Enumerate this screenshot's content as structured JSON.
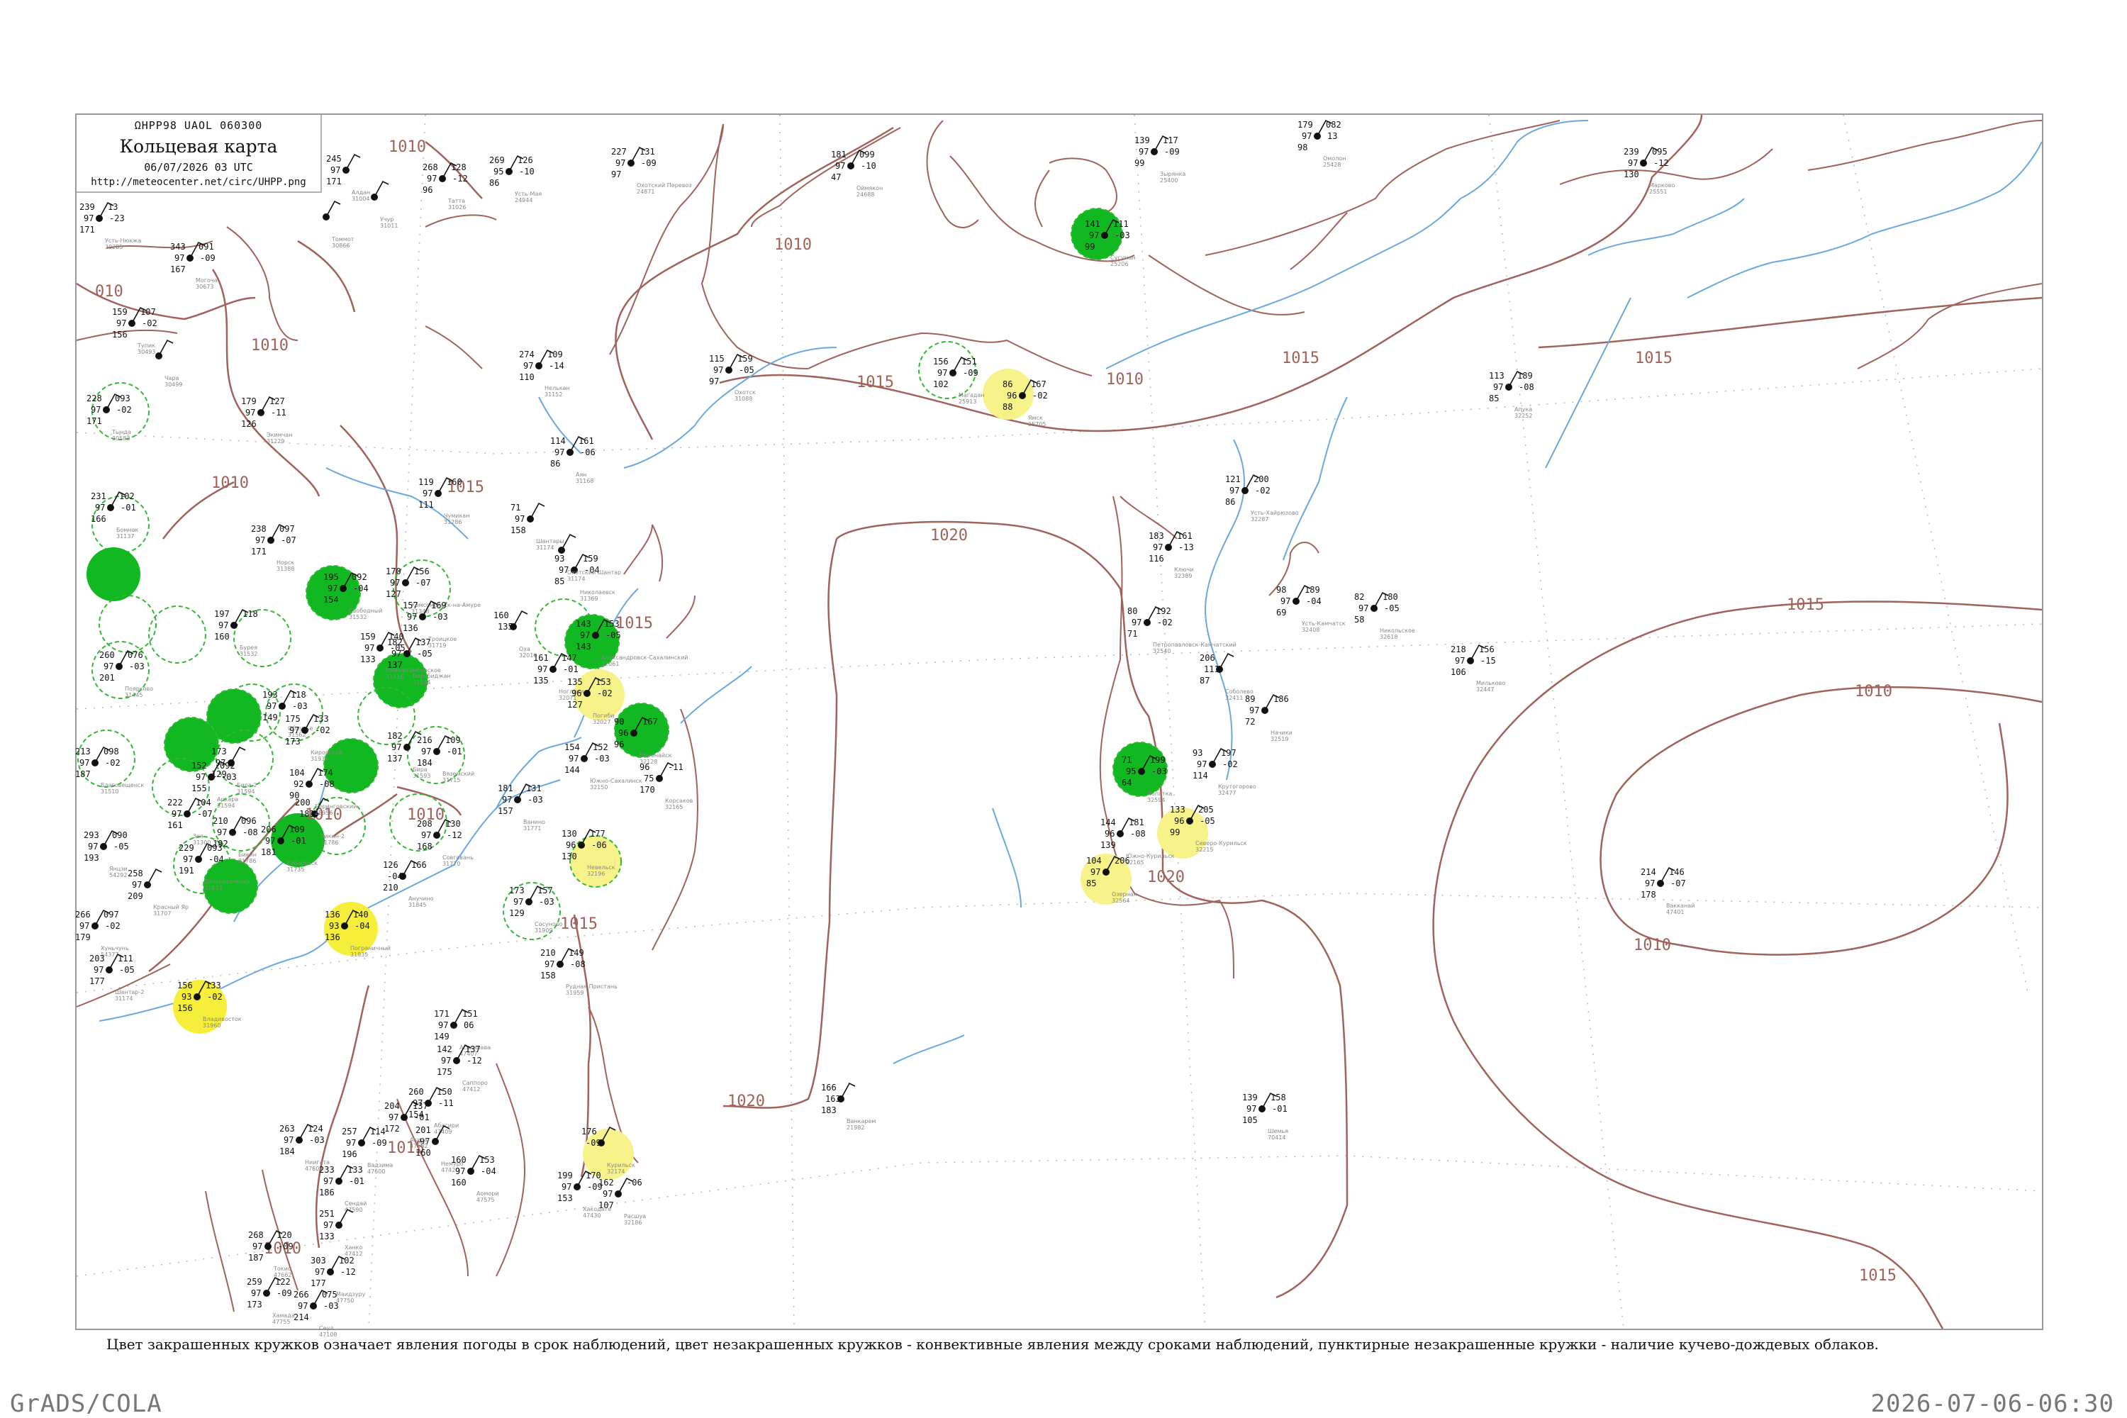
{
  "header": {
    "code": "ΩHPP98  UAOL  060300",
    "title": "Кольцевая карта",
    "date": "06/07/2026 03 UTC",
    "url": "http://meteocenter.net/circ/UHPP.png"
  },
  "caption": "Цвет закрашенных кружков означает явления погоды в срок наблюдений, цвет незакрашенных кружков - конвективные явления между сроками наблюдений, пунктирные незакрашенные кружки - наличие кучево-дождевых облаков.",
  "footer": {
    "left": "GrADS/COLA",
    "right": "2026-07-06-06:30"
  },
  "colors": {
    "isobar": "#a0625a",
    "coast": "#a0625a",
    "river": "#6aa8e0",
    "green": "#11b821",
    "yellow": "#f5ee3a",
    "light_yellow": "#f7f28a",
    "dashed_green": "#33b833",
    "frame": "#9a9a9a"
  },
  "isobar_labels": [
    "010",
    "1010",
    "1010",
    "1010",
    "1010",
    "1015",
    "1015",
    "1010",
    "1015",
    "1020",
    "1015",
    "1010",
    "1010",
    "1015",
    "1010",
    "1010",
    "1015",
    "1015",
    "1015",
    "1020",
    "1020",
    "1010",
    "1015"
  ],
  "stations": [
    {
      "name": "Усть-Нюкжа",
      "id": "30285",
      "obs": [
        "239",
        "97",
        "171",
        "13",
        "-23"
      ],
      "marker": "none"
    },
    {
      "name": "Могоча",
      "id": "30673",
      "obs": [
        "343",
        "97",
        "167",
        "091",
        "-09"
      ],
      "marker": "none"
    },
    {
      "name": "Тупик",
      "id": "30493",
      "obs": [
        "159",
        "97",
        "156",
        "107",
        "-02"
      ],
      "marker": "none"
    },
    {
      "name": "Чара",
      "id": "30499",
      "obs": [],
      "marker": "none"
    },
    {
      "name": "Алдан",
      "id": "31004",
      "obs": [
        "245",
        "97",
        "171"
      ],
      "marker": "none"
    },
    {
      "name": "Томмот",
      "id": "30866",
      "obs": [],
      "marker": "none"
    },
    {
      "name": "Учур",
      "id": "31011",
      "obs": [],
      "marker": "none"
    },
    {
      "name": "Татта",
      "id": "31026",
      "obs": [
        "268",
        "97",
        "96",
        "128",
        "-12"
      ],
      "marker": "none"
    },
    {
      "name": "Усть-Мая",
      "id": "24944",
      "obs": [
        "269",
        "95",
        "86",
        "126",
        "-10"
      ],
      "marker": "none"
    },
    {
      "name": "Оймякон",
      "id": "24688",
      "obs": [
        "181",
        "97",
        "47",
        "099",
        "-10"
      ],
      "marker": "none"
    },
    {
      "name": "Охотский Перевоз",
      "id": "24871",
      "obs": [
        "227",
        "97",
        "97",
        "131",
        "-09"
      ],
      "marker": "none"
    },
    {
      "name": "Зырянка",
      "id": "25400",
      "obs": [
        "139",
        "97",
        "99",
        "117",
        "-09"
      ],
      "marker": "none"
    },
    {
      "name": "Омолон",
      "id": "25428",
      "obs": [
        "179",
        "97",
        "98",
        "082",
        "13"
      ],
      "marker": "none"
    },
    {
      "name": "Марково",
      "id": "25551",
      "obs": [
        "239",
        "97",
        "130",
        "095",
        "-12"
      ],
      "marker": "none"
    },
    {
      "name": "Сусуман",
      "id": "25206",
      "obs": [
        "141",
        "97",
        "99",
        "111",
        "-03"
      ],
      "marker": "green"
    },
    {
      "name": "Аян",
      "id": "31168",
      "obs": [
        "114",
        "97",
        "86",
        "161",
        "-06"
      ],
      "marker": "none"
    },
    {
      "name": "Магадан",
      "id": "25913",
      "obs": [
        "156",
        "97",
        "102",
        "151",
        "-09"
      ],
      "marker": "dashed-green"
    },
    {
      "name": "Ямск",
      "id": "25705",
      "obs": [
        "86",
        "96",
        "88",
        "167",
        "-02"
      ],
      "marker": "light-yellow"
    },
    {
      "name": "Охотск",
      "id": "31088",
      "obs": [
        "115",
        "97",
        "97",
        "159",
        "-05"
      ],
      "marker": "none"
    },
    {
      "name": "Нелькан",
      "id": "31152",
      "obs": [
        "274",
        "97",
        "110",
        "109",
        "-14"
      ],
      "marker": "none"
    },
    {
      "name": "Чумикан",
      "id": "31286",
      "obs": [
        "119",
        "97",
        "111",
        "160"
      ],
      "marker": "none"
    },
    {
      "name": "Шантары",
      "id": "31174",
      "obs": [
        "71",
        "97",
        "158"
      ],
      "marker": "none"
    },
    {
      "name": "Николаевск",
      "id": "31369",
      "obs": [
        "93",
        "97",
        "85",
        "159",
        "-04"
      ],
      "marker": "none"
    },
    {
      "name": "Охотский Шантар",
      "id": "31174",
      "obs": [],
      "marker": "none"
    },
    {
      "name": "Оха",
      "id": "32010",
      "obs": [
        "160",
        "135"
      ],
      "marker": "none"
    },
    {
      "name": "Александровск-Сахалинский",
      "id": "32061",
      "obs": [
        "143",
        "97",
        "143",
        "153",
        "-05"
      ],
      "marker": "green"
    },
    {
      "name": "Ноглики",
      "id": "32071",
      "obs": [
        "161",
        "97",
        "135",
        "147",
        "-01"
      ],
      "marker": "none"
    },
    {
      "name": "Погиби",
      "id": "32027",
      "obs": [
        "135",
        "96",
        "127",
        "153",
        "-02"
      ],
      "marker": "light-yellow"
    },
    {
      "name": "Поронайск",
      "id": "32128",
      "obs": [
        "90",
        "96",
        "96",
        "167"
      ],
      "marker": "green"
    },
    {
      "name": "Южно-Сахалинск",
      "id": "32150",
      "obs": [
        "154",
        "97",
        "144",
        "152",
        "-03"
      ],
      "marker": "none"
    },
    {
      "name": "Корсаков",
      "id": "32165",
      "obs": [
        "96",
        "75",
        "170",
        "-11"
      ],
      "marker": "none"
    },
    {
      "name": "Невельск",
      "id": "32196",
      "obs": [
        "130",
        "96",
        "130",
        "177",
        "-06"
      ],
      "marker": "light-yellow"
    },
    {
      "name": "Совгавань",
      "id": "31770",
      "obs": [
        "208",
        "97",
        "168",
        "130",
        "-12"
      ],
      "marker": "none"
    },
    {
      "name": "Ванино",
      "id": "31771",
      "obs": [
        "181",
        "97",
        "157",
        "131",
        "-03"
      ],
      "marker": "none"
    },
    {
      "name": "Сосуново",
      "id": "31909",
      "obs": [
        "173",
        "97",
        "129",
        "157",
        "-03"
      ],
      "marker": "dashed-green"
    },
    {
      "name": "Рудная Пристань",
      "id": "31959",
      "obs": [
        "210",
        "97",
        "158",
        "149",
        "-08"
      ],
      "marker": "none"
    },
    {
      "name": "Владивосток",
      "id": "31960",
      "obs": [
        "156",
        "93",
        "156",
        "133",
        "-02"
      ],
      "marker": "yellow"
    },
    {
      "name": "Пограничный",
      "id": "31835",
      "obs": [
        "136",
        "93",
        "136",
        "140",
        "-04"
      ],
      "marker": "yellow"
    },
    {
      "name": "Анучино",
      "id": "31845",
      "obs": [
        "126",
        "-04",
        "210",
        "166"
      ],
      "marker": "none"
    },
    {
      "name": "Хабаровск",
      "id": "31735",
      "obs": [
        "206",
        "97",
        "181",
        "109",
        "-01"
      ],
      "marker": "green"
    },
    {
      "name": "Бикин",
      "id": "31786",
      "obs": [
        "210",
        "97",
        "192",
        "096",
        "-08"
      ],
      "marker": "dashed-green"
    },
    {
      "name": "Дальнереченск",
      "id": "31873",
      "obs": [
        "229",
        "97",
        "191",
        "093",
        "-04"
      ],
      "marker": "dashed-green"
    },
    {
      "name": "Красный Яр",
      "id": "31707",
      "obs": [
        "258",
        "97",
        "209"
      ],
      "marker": "none"
    },
    {
      "name": "Благовещенск",
      "id": "31510",
      "obs": [
        "213",
        "97",
        "187",
        "098",
        "-02"
      ],
      "marker": "dashed-green"
    },
    {
      "name": "Поярково",
      "id": "31445",
      "obs": [
        "260",
        "97",
        "201",
        "076",
        "-03"
      ],
      "marker": "dashed-green"
    },
    {
      "name": "Архара",
      "id": "31594",
      "obs": [
        "152",
        "97",
        "155",
        "092",
        "-03"
      ],
      "marker": "dashed-green"
    },
    {
      "name": "Тында",
      "id": "30583",
      "obs": [
        "228",
        "97",
        "171",
        "093",
        "-02"
      ],
      "marker": "dashed-green"
    },
    {
      "name": "Экимчан",
      "id": "31229",
      "obs": [
        "179",
        "97",
        "126",
        "127",
        "-11"
      ],
      "marker": "none"
    },
    {
      "name": "Бомнак",
      "id": "31137",
      "obs": [
        "231",
        "97",
        "166",
        "102",
        "-01"
      ],
      "marker": "dashed-green"
    },
    {
      "name": "Норск",
      "id": "31388",
      "obs": [
        "238",
        "97",
        "171",
        "097",
        "-07"
      ],
      "marker": "none"
    },
    {
      "name": "Зея",
      "id": "31300",
      "obs": [
        "222",
        "97",
        "161",
        "104",
        "-07"
      ],
      "marker": "green"
    },
    {
      "name": "Свободный",
      "id": "31532",
      "obs": [
        "195",
        "97",
        "154",
        "092",
        "-04"
      ],
      "marker": "dashed-green"
    },
    {
      "name": "Бурея",
      "id": "31532",
      "obs": [
        "197",
        "97",
        "160",
        "118"
      ],
      "marker": "dashed-green"
    },
    {
      "name": "Облучье",
      "id": "31562",
      "obs": [
        "193",
        "97",
        "149",
        "118",
        "-03"
      ],
      "marker": "green"
    },
    {
      "name": "Биробиджан",
      "id": "31594",
      "obs": [
        "182",
        "97",
        "137",
        "137",
        "-05"
      ],
      "marker": "none"
    },
    {
      "name": "Комсомольск-на-Амуре",
      "id": "31348",
      "obs": [
        "170",
        "97",
        "127",
        "156",
        "-07"
      ],
      "marker": "dashed-green"
    },
    {
      "name": "Бира",
      "id": "31593",
      "obs": [
        "182",
        "97",
        "137"
      ],
      "marker": "none"
    },
    {
      "name": "Нижнетамбовское",
      "id": "31416",
      "obs": [
        "159",
        "97",
        "133",
        "140",
        "-05"
      ],
      "marker": "none"
    },
    {
      "name": "Троицкое",
      "id": "31719",
      "obs": [
        "157",
        "97",
        "136",
        "169",
        "-03"
      ],
      "marker": "dashed-green"
    },
    {
      "name": "Вяземский",
      "id": "31715",
      "obs": [
        "216",
        "97",
        "184",
        "109",
        "-01"
      ],
      "marker": "none"
    },
    {
      "name": "Бикин-2",
      "id": "31786",
      "obs": [
        "200",
        "181"
      ],
      "marker": "none"
    },
    {
      "name": "Беринговский",
      "id": "25956",
      "obs": [
        "104",
        "92",
        "90",
        "174",
        "-08"
      ],
      "marker": "none"
    },
    {
      "name": "Апука",
      "id": "32252",
      "obs": [
        "113",
        "97",
        "85",
        "189",
        "-08"
      ],
      "marker": "none"
    },
    {
      "name": "Усть-Хайрюзово",
      "id": "32287",
      "obs": [
        "121",
        "97",
        "86",
        "200",
        "-02"
      ],
      "marker": "none"
    },
    {
      "name": "Ключи",
      "id": "32389",
      "obs": [
        "183",
        "97",
        "116",
        "161",
        "-13"
      ],
      "marker": "none"
    },
    {
      "name": "Усть-Камчатск",
      "id": "32408",
      "obs": [
        "98",
        "97",
        "69",
        "189",
        "-04"
      ],
      "marker": "none"
    },
    {
      "name": "Никольское",
      "id": "32618",
      "obs": [
        "82",
        "97",
        "58",
        "180",
        "-05"
      ],
      "marker": "none"
    },
    {
      "name": "Мильково",
      "id": "32447",
      "obs": [
        "218",
        "97",
        "106",
        "156",
        "-15"
      ],
      "marker": "none"
    },
    {
      "name": "Соболево",
      "id": "32411",
      "obs": [
        "206",
        "111",
        "87"
      ],
      "marker": "none"
    },
    {
      "name": "Петропавловск-Камчатский",
      "id": "32540",
      "obs": [
        "80",
        "97",
        "71",
        "192",
        "-02"
      ],
      "marker": "none"
    },
    {
      "name": "Начики",
      "id": "32519",
      "obs": [
        "89",
        "97",
        "72",
        "186"
      ],
      "marker": "none"
    },
    {
      "name": "Крутогорово",
      "id": "32477",
      "obs": [
        "93",
        "97",
        "114",
        "197",
        "-02"
      ],
      "marker": "green"
    },
    {
      "name": "Лопатка",
      "id": "32594",
      "obs": [
        "71",
        "95",
        "64",
        "199",
        "-03"
      ],
      "marker": "light-yellow"
    },
    {
      "name": "Северо-Курильск",
      "id": "32215",
      "obs": [
        "133",
        "96",
        "99",
        "205",
        "-05"
      ],
      "marker": "light-yellow"
    },
    {
      "name": "Озерная",
      "id": "32564",
      "obs": [
        "104",
        "97",
        "85",
        "206"
      ],
      "marker": "none"
    },
    {
      "name": "Южно-Курильск",
      "id": "32165",
      "obs": [
        "144",
        "96",
        "139",
        "181",
        "-08"
      ],
      "marker": "light-yellow"
    },
    {
      "name": "Курильск",
      "id": "32174",
      "obs": [
        "176",
        "-09"
      ],
      "marker": "none"
    },
    {
      "name": "Расшуа",
      "id": "32186",
      "obs": [
        "162",
        "97",
        "107",
        "-06"
      ],
      "marker": "none"
    },
    {
      "name": "Ванкарем",
      "id": "21982",
      "obs": [
        "166",
        "163",
        "183"
      ],
      "marker": "none"
    },
    {
      "name": "Шемья",
      "id": "70414",
      "obs": [
        "139",
        "97",
        "105",
        "158",
        "-01"
      ],
      "marker": "none"
    },
    {
      "name": "Вакканай",
      "id": "47401",
      "obs": [
        "214",
        "97",
        "178",
        "146",
        "-07"
      ],
      "marker": "none"
    },
    {
      "name": "Асахикава",
      "id": "47407",
      "obs": [
        "171",
        "97",
        "149",
        "151",
        "06"
      ],
      "marker": "none"
    },
    {
      "name": "Саппоро",
      "id": "47412",
      "obs": [
        "142",
        "97",
        "175",
        "137",
        "-12"
      ],
      "marker": "none"
    },
    {
      "name": "Абасири",
      "id": "47409",
      "obs": [
        "260",
        "97",
        "154",
        "150",
        "-11"
      ],
      "marker": "none"
    },
    {
      "name": "Немуро",
      "id": "47420",
      "obs": [
        "201",
        "97",
        "160"
      ],
      "marker": "none"
    },
    {
      "name": "Хакодате",
      "id": "47430",
      "obs": [
        "199",
        "97",
        "153",
        "170",
        "-09"
      ],
      "marker": "none"
    },
    {
      "name": "Аомори",
      "id": "47575",
      "obs": [
        "160",
        "97",
        "160",
        "153",
        "-04"
      ],
      "marker": "none"
    },
    {
      "name": "Акита",
      "id": "47582",
      "obs": [
        "204",
        "97",
        "172",
        "137",
        "-01"
      ],
      "marker": "none"
    },
    {
      "name": "Ниигата",
      "id": "47604",
      "obs": [
        "263",
        "97",
        "184",
        "124",
        "-03"
      ],
      "marker": "none"
    },
    {
      "name": "Сендай",
      "id": "47590",
      "obs": [
        "233",
        "97",
        "186",
        "133",
        "-01"
      ],
      "marker": "none"
    },
    {
      "name": "Ханко",
      "id": "47412",
      "obs": [
        "251",
        "97",
        "133"
      ],
      "marker": "none"
    },
    {
      "name": "Вадзима",
      "id": "47600",
      "obs": [
        "257",
        "97",
        "196",
        "114",
        "-09"
      ],
      "marker": "none"
    },
    {
      "name": "Токио",
      "id": "47662",
      "obs": [
        "268",
        "97",
        "187",
        "120",
        "-09"
      ],
      "marker": "none"
    },
    {
      "name": "Маидзуру",
      "id": "47750",
      "obs": [
        "303",
        "97",
        "177",
        "102",
        "-12"
      ],
      "marker": "none"
    },
    {
      "name": "Хамада",
      "id": "47755",
      "obs": [
        "259",
        "97",
        "173",
        "122",
        "-09"
      ],
      "marker": "none"
    },
    {
      "name": "Сеул",
      "id": "47108",
      "obs": [
        "266",
        "97",
        "214",
        "075",
        "-03"
      ],
      "marker": "none"
    },
    {
      "name": "Янцзи",
      "id": "54292",
      "obs": [
        "293",
        "97",
        "193",
        "090",
        "-05"
      ],
      "marker": "none"
    },
    {
      "name": "Хуньчунь",
      "id": "54377",
      "obs": [
        "266",
        "97",
        "179",
        "097",
        "-02"
      ],
      "marker": "none"
    },
    {
      "name": "Шантар-2",
      "id": "31174",
      "obs": [
        "203",
        "97",
        "177",
        "111",
        "-05"
      ],
      "marker": "dashed-green"
    },
    {
      "name": "Бира-2",
      "id": "31594",
      "obs": [
        "173",
        "97",
        "129"
      ],
      "marker": "none"
    },
    {
      "name": "Кировский",
      "id": "31938",
      "obs": [
        "175",
        "97",
        "173",
        "133",
        "-02"
      ],
      "marker": "none"
    }
  ]
}
